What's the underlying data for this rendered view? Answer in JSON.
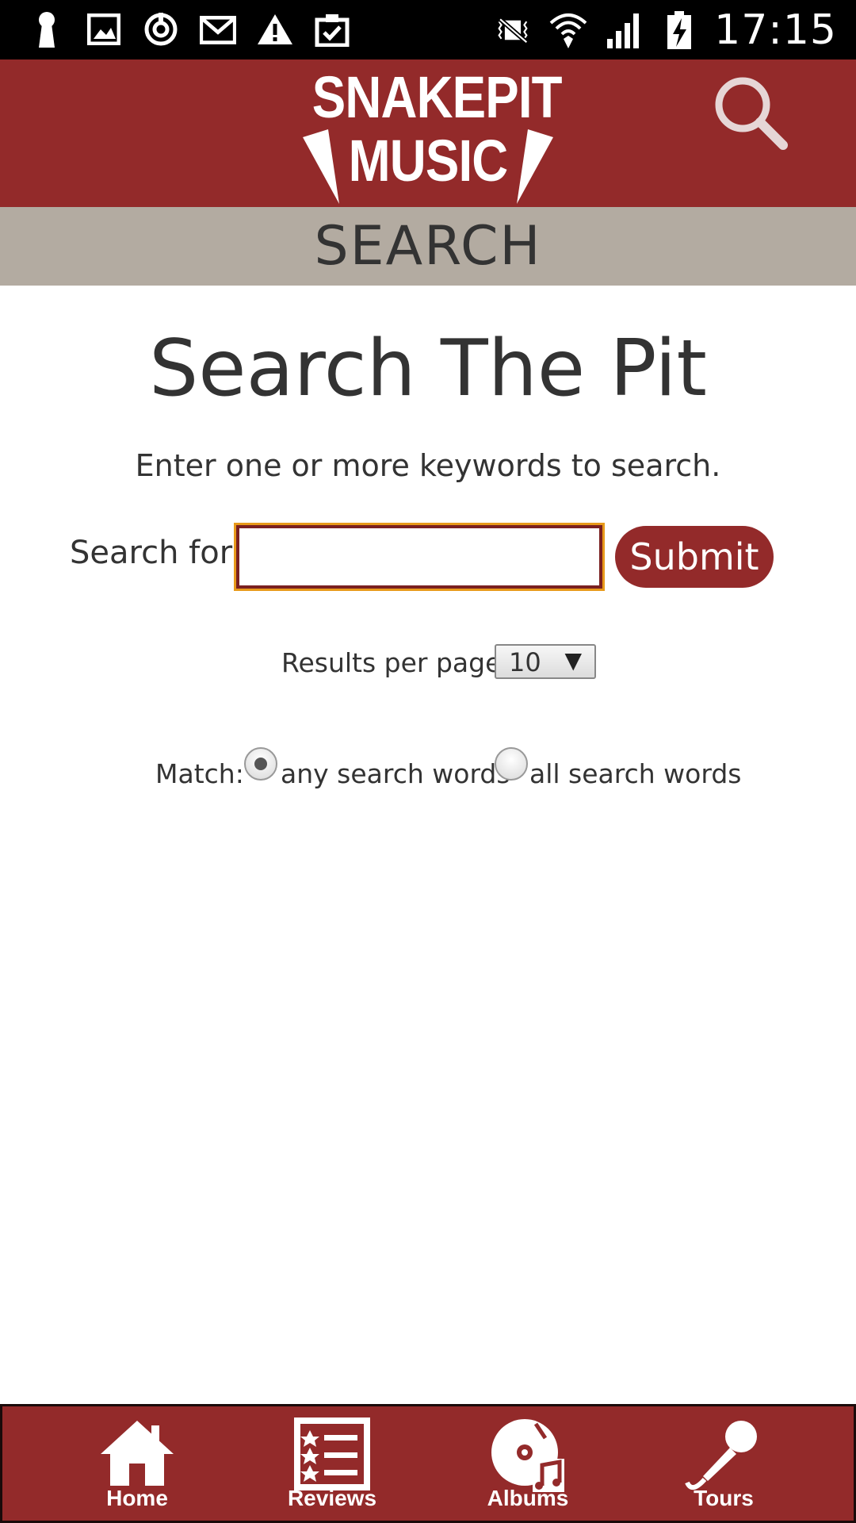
{
  "status_bar": {
    "time": "17:15",
    "left_icons": [
      "keyhole-icon",
      "image-icon",
      "sync-icon",
      "gmail-icon",
      "warning-icon",
      "clipboard-check-icon"
    ],
    "right_icons": [
      "vibrate-mute-icon",
      "wifi-icon",
      "signal-icon",
      "battery-charging-icon"
    ]
  },
  "header": {
    "logo_line1": "SNAKEPIT",
    "logo_line2": "MUSIC",
    "search_icon": "search-icon",
    "background": "#932a2a"
  },
  "section": {
    "title": "SEARCH"
  },
  "main": {
    "title": "Search The Pit",
    "intro": "Enter one or more keywords to search.",
    "search_label": "Search for:",
    "search_value": "",
    "submit_label": "Submit",
    "results_label": "Results per page:",
    "results_value": "10",
    "match_label": "Match:",
    "match_any_label": "any search words",
    "match_all_label": "all search words",
    "match_selected": "any"
  },
  "bottom_nav": {
    "items": [
      {
        "label": "Home",
        "icon": "home-icon"
      },
      {
        "label": "Reviews",
        "icon": "reviews-list-icon"
      },
      {
        "label": "Albums",
        "icon": "album-disc-icon"
      },
      {
        "label": "Tours",
        "icon": "microphone-icon"
      }
    ]
  },
  "colors": {
    "brand": "#932a2a",
    "banner": "#b3aba1",
    "focus_outline": "#e89a1a"
  }
}
